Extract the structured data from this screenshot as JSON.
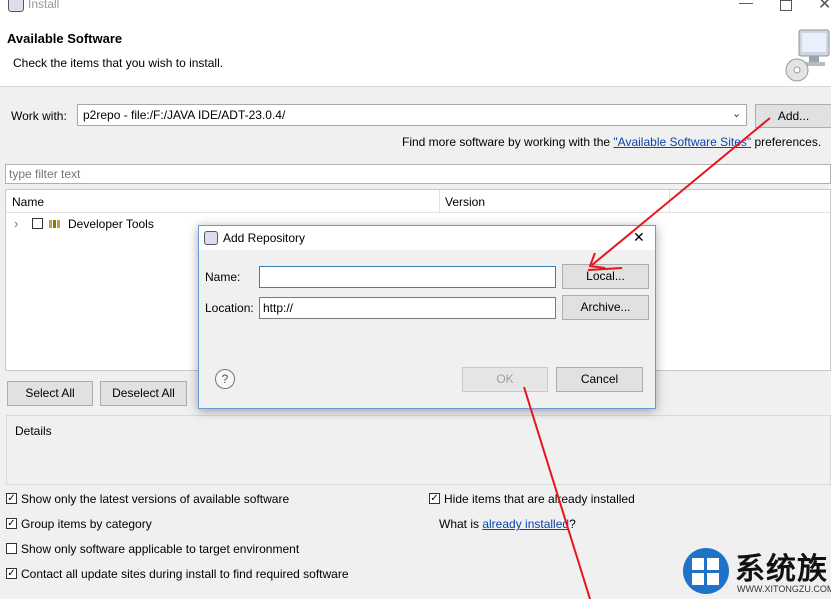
{
  "window": {
    "title": "Install",
    "minimize": "—",
    "close": "✕"
  },
  "banner": {
    "heading": "Available Software",
    "subtitle": "Check the items that you wish to install."
  },
  "work_with": {
    "label": "Work with:",
    "value": "p2repo - file:/F:/JAVA IDE/ADT-23.0.4/",
    "add_button": "Add...",
    "hint_prefix": "Find more software by working with the ",
    "hint_link": "\"Available Software Sites\"",
    "hint_suffix": " preferences."
  },
  "filter": {
    "placeholder": "type filter text"
  },
  "table": {
    "columns": [
      "Name",
      "Version"
    ],
    "rows": [
      {
        "expander": "›",
        "label": "Developer Tools",
        "checked": false
      }
    ]
  },
  "select_all": "Select All",
  "deselect_all": "Deselect All",
  "details": {
    "label": "Details"
  },
  "options": {
    "show_latest": {
      "label": "Show only the latest versions of available software",
      "checked": true
    },
    "group_by_category": {
      "label": "Group items by category",
      "checked": true
    },
    "target_env": {
      "label": "Show only software applicable to target environment",
      "checked": false
    },
    "contact_sites": {
      "label": "Contact all update sites during install to find required software",
      "checked": true
    },
    "hide_installed": {
      "label": "Hide items that are already installed",
      "checked": true
    },
    "what_is_prefix": "What is ",
    "what_is_link": "already installed",
    "what_is_suffix": "?"
  },
  "dialog": {
    "title": "Add Repository",
    "name_label": "Name:",
    "name_value": "",
    "local_button": "Local...",
    "location_label": "Location:",
    "location_value": "http://",
    "archive_button": "Archive...",
    "help": "?",
    "ok_button": "OK",
    "cancel_button": "Cancel"
  },
  "watermark": {
    "brand": "系统族",
    "url": "WWW.XITONGZU.COM"
  },
  "colors": {
    "arrow": "#e8141c",
    "link": "#0645ad",
    "dialog_border": "#6a9bd8",
    "checkmark": "#000000"
  }
}
